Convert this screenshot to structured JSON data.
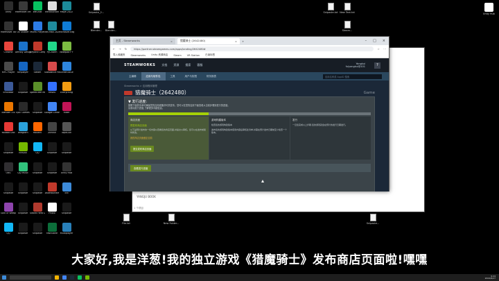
{
  "desktop_icons": [
    {
      "label": "Unity",
      "color": "#2d2d2d"
    },
    {
      "label": "Marmoset Viewer",
      "color": "#3a3a3a"
    },
    {
      "label": "WeChat",
      "color": "#07c160"
    },
    {
      "label": "Introduction",
      "color": "#dddddd"
    },
    {
      "label": "Maya 2022",
      "color": "#1c8a99"
    },
    {
      "label": "Marmoset Toolbag 4",
      "color": "#333333"
    },
    {
      "label": "UE Shader",
      "color": "#ffffff"
    },
    {
      "label": "MuMu Player",
      "color": "#2c7be5"
    },
    {
      "label": "3ds Max 2021",
      "color": "#1f8b9c"
    },
    {
      "label": "Microsoft Edge",
      "color": "#0f7bd4"
    },
    {
      "label": "Chrome",
      "color": "#e8453c"
    },
    {
      "label": "Affinity Designer",
      "color": "#1b72c9"
    },
    {
      "label": "Beyond Compare 4",
      "color": "#c0392b"
    },
    {
      "label": "PyCharm",
      "color": "#21d789"
    },
    {
      "label": "Notepad++",
      "color": "#7cbb42"
    },
    {
      "label": "MPC Player",
      "color": "#4a4a4a"
    },
    {
      "label": "Kmplayer",
      "color": "#1565c0"
    },
    {
      "label": "Steam",
      "color": "#1b2838"
    },
    {
      "label": "Substance Painter",
      "color": "#d74b4b"
    },
    {
      "label": "ScreenToGif",
      "color": "#2e86de"
    },
    {
      "label": "EmEditor",
      "color": "#3b5998"
    },
    {
      "label": "Snipaste",
      "color": "#1a1a1a"
    },
    {
      "label": "SpeedTree Modeler",
      "color": "#5a8f29"
    },
    {
      "label": "Feishu",
      "color": "#3370ff"
    },
    {
      "label": "Everything",
      "color": "#f39c12"
    },
    {
      "label": "Blender 3.6",
      "color": "#ea7600"
    },
    {
      "label": "Epic Games",
      "color": "#2a2a2a"
    },
    {
      "label": "Snipaste",
      "color": "#1a1a1a"
    },
    {
      "label": "Google Chrome",
      "color": "#4285f4"
    },
    {
      "label": "Rider",
      "color": "#c21456"
    },
    {
      "label": "Youdao Dict",
      "color": "#e53935"
    },
    {
      "label": "Telegram",
      "color": "#2aa1da"
    },
    {
      "label": "Houdini",
      "color": "#ff6600"
    },
    {
      "label": "ZBrush",
      "color": "#444444"
    },
    {
      "label": "TopoGun",
      "color": "#555555"
    },
    {
      "label": "Snipaste",
      "color": "#1a1a1a"
    },
    {
      "label": "NVIDIA",
      "color": "#76b900"
    },
    {
      "label": "QQ",
      "color": "#12b7f5"
    },
    {
      "label": "Snipaste",
      "color": "#1a1a1a"
    },
    {
      "label": "Snipaste",
      "color": "#1a1a1a"
    },
    {
      "label": "OBS",
      "color": "#302e31"
    },
    {
      "label": "QQ Music",
      "color": "#31c27c"
    },
    {
      "label": "Snipaste",
      "color": "#1a1a1a"
    },
    {
      "label": "Snipaste",
      "color": "#1a1a1a"
    },
    {
      "label": "Unity Hub",
      "color": "#333333"
    },
    {
      "label": "Snipaste",
      "color": "#1a1a1a"
    },
    {
      "label": "Snipaste",
      "color": "#1a1a1a"
    },
    {
      "label": "Snipaste",
      "color": "#1a1a1a"
    },
    {
      "label": "AssetBundle",
      "color": "#c0392b"
    },
    {
      "label": "Edi",
      "color": "#3d8bd9"
    },
    {
      "label": "God Of Weapon",
      "color": "#8e44ad"
    },
    {
      "label": "Snipaste",
      "color": "#1a1a1a"
    },
    {
      "label": "Sword Hero Demo",
      "color": "#b03a2e"
    },
    {
      "label": "Photo",
      "color": "#ffffff"
    },
    {
      "label": "Snipaste",
      "color": "#1a1a1a"
    },
    {
      "label": "QQ",
      "color": "#12b7f5"
    },
    {
      "label": "Snipaste",
      "color": "#1a1a1a"
    },
    {
      "label": "Snipaste",
      "color": "#1a1a1a"
    },
    {
      "label": "FastStone",
      "color": "#0c6e3a"
    },
    {
      "label": "Multiplayer",
      "color": "#2980b9"
    }
  ],
  "desktop_files": [
    {
      "label": "Snipaste_2..."
    },
    {
      "label": "Blender..."
    },
    {
      "label": "Blender..."
    },
    {
      "label": "Snipaste.txt"
    },
    {
      "label": "New Text.txt"
    },
    {
      "label": "Steam..."
    },
    {
      "label": "File.txt"
    },
    {
      "label": "New Folder..."
    },
    {
      "label": "Snipaste..."
    }
  ],
  "top_right_icon": {
    "label": "Unity Hub"
  },
  "explorer": {
    "footer_item": "YANGJU BOOK",
    "status": "1 个项目"
  },
  "browser": {
    "tabs": [
      {
        "label": "主页 - Steamworks"
      },
      {
        "label": "猎魔骑士 (2642480)"
      }
    ],
    "url": "https://partner.steamgames.com/apps/landing/2642480#",
    "bookmarks": [
      "导入收藏夹",
      "Steamworks",
      "Unity 资源商店",
      "Steam",
      "VR Station",
      "已读标签"
    ]
  },
  "steam": {
    "logo": "STEAMWORKS",
    "nav": [
      "文档",
      "资源",
      "搜索",
      "客服"
    ],
    "user": "Yangkui",
    "user_sub": "fulyangkui@101",
    "help_label": "?",
    "subnav": [
      "主编辑",
      "应用与软件包",
      "工具",
      "用户与权限",
      "财务报表"
    ],
    "search_placeholder": "应用名称或 AppID 搜索",
    "breadcrumb": "Steamworks > 应用程序管理",
    "app_title": "猎魔骑士（2642480）",
    "app_type": "Game",
    "checklist": {
      "title": "▼ 发行进度:",
      "intro": "按照下面的清单可确保您的应用准备好可供发布。您可以在您的应用下面查看从当前步骤到发行的进度。",
      "link": "请参阅发行进度,了解更多详细信息。",
      "progress": 0.33,
      "columns": [
        {
          "head": "商店页面",
          "sub": "预发布商店页面",
          "body": "以下是预计发布的一切内容以查看您的商店页面,并提交以审核。您可以在发布前随时修改。",
          "link": "我的商店页面截至目前",
          "button": "提交发布商店页面"
        },
        {
          "head": "游戏构建版本",
          "sub": "检查您的游戏构建版本",
          "body": "发布您的游戏构建版本使用内容后审核此清单,并需在预计发布日期前至少检查一个版本。",
          "link": "",
          "button": ""
        },
        {
          "head": "发行",
          "sub": "",
          "body": "一旦您完成以上步骤,您的游戏就会在预计的发行日期发行。",
          "link": "",
          "button": ""
        }
      ],
      "bottom_button": "查看发行进度"
    }
  },
  "subtitle": "大家好,我是洋葱!我的独立游戏《猎魔骑士》发布商店页面啦!嘿嘿",
  "taskbar": {
    "time": "9:24",
    "date": "2024/8/27"
  }
}
